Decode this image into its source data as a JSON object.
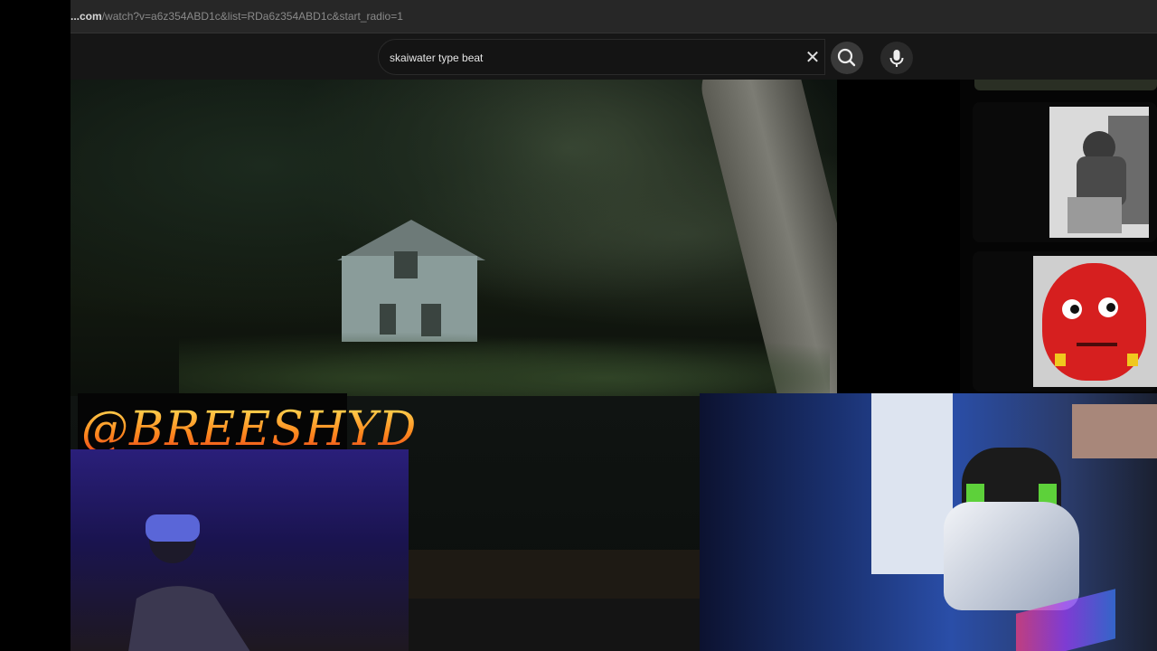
{
  "browser": {
    "url_domain": "...com",
    "url_path": "/watch?v=a6z354ABD1c&list=RDa6z354ABD1c&start_radio=1"
  },
  "search": {
    "query": "skaiwater type beat",
    "clear_icon": "close-icon",
    "search_icon": "search-icon",
    "mic_icon": "microphone-icon"
  },
  "overlay": {
    "handle": "@BREESHYD"
  },
  "colors": {
    "handle_gradient": [
      "#ffe35a",
      "#ff8b1f",
      "#e8401a"
    ],
    "header_bg": "#161616",
    "urlbar_bg": "#272727"
  }
}
